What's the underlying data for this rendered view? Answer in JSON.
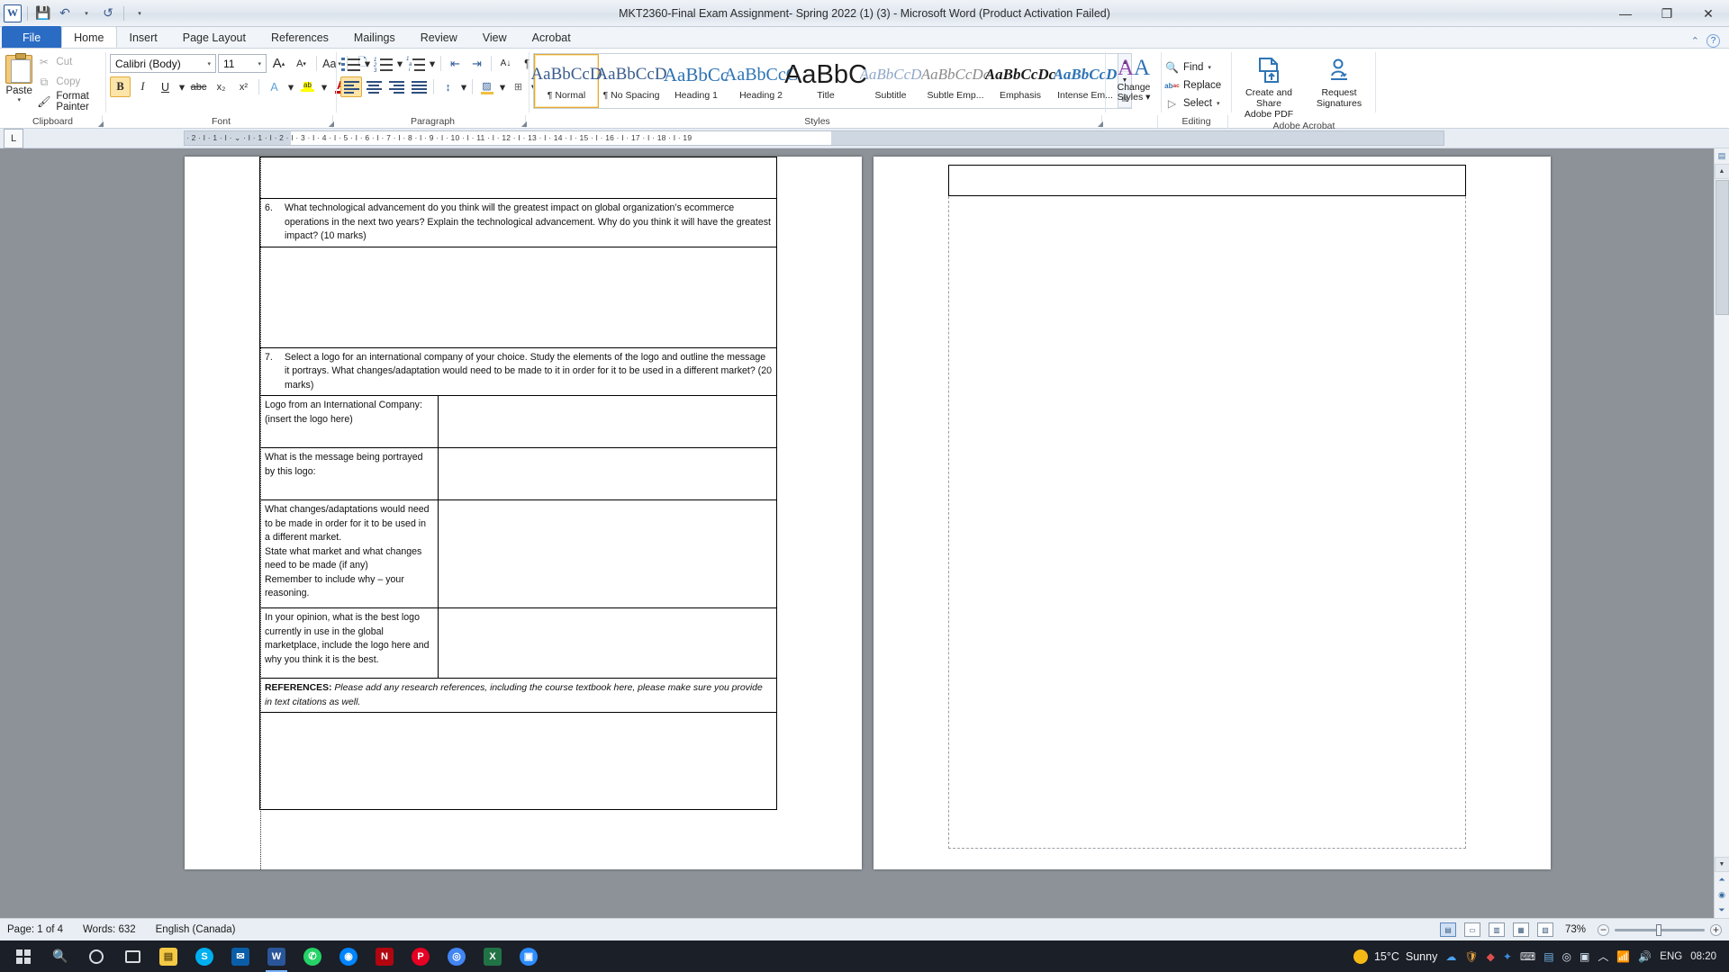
{
  "window": {
    "title": "MKT2360-Final Exam Assignment- Spring 2022 (1) (3)  -  Microsoft Word (Product Activation Failed)",
    "minimize": "—",
    "restore": "❐",
    "close": "✕"
  },
  "quick_access": {
    "logo": "W",
    "save": "💾",
    "undo": "↶",
    "undo_caret": "▾",
    "redo": "↺",
    "customize": "▾"
  },
  "ribbon_tabs": [
    {
      "label": "File",
      "id": "file"
    },
    {
      "label": "Home",
      "id": "home"
    },
    {
      "label": "Insert",
      "id": "insert"
    },
    {
      "label": "Page Layout",
      "id": "page-layout"
    },
    {
      "label": "References",
      "id": "references"
    },
    {
      "label": "Mailings",
      "id": "mailings"
    },
    {
      "label": "Review",
      "id": "review"
    },
    {
      "label": "View",
      "id": "view"
    },
    {
      "label": "Acrobat",
      "id": "acrobat"
    }
  ],
  "ribbon_right": {
    "minimize_ribbon": "⌃",
    "help": "?"
  },
  "groups": {
    "clipboard": {
      "label": "Clipboard",
      "paste": "Paste",
      "paste_caret": "▾",
      "cut": "Cut",
      "copy": "Copy",
      "format_painter": "Format Painter",
      "cut_icon": "✂",
      "copy_icon": "⧉",
      "painter_icon": "🖌"
    },
    "font": {
      "label": "Font",
      "font_name": "Calibri (Body)",
      "font_size": "11",
      "grow": "A",
      "shrink": "A",
      "change_case": "Aa",
      "clear_formatting": "A",
      "bold": "B",
      "italic": "I",
      "underline": "U",
      "strikethrough": "abc",
      "subscript": "x₂",
      "superscript": "x²",
      "text_effects": "A",
      "highlight": "ab",
      "font_color": "A"
    },
    "paragraph": {
      "label": "Paragraph",
      "bullets": "bullets-icon",
      "numbering": "numbering-icon",
      "multilevel": "multilevel-list-icon",
      "decrease_indent": "⇤",
      "increase_indent": "⇥",
      "sort": "A↓",
      "show_marks": "¶",
      "align_left": "align-left-icon",
      "align_center": "align-center-icon",
      "align_right": "align-right-icon",
      "justify": "justify-icon",
      "line_spacing": "↕",
      "shading": "shading-icon",
      "borders": "borders-icon"
    },
    "styles": {
      "label": "Styles",
      "items": [
        {
          "preview": "AaBbCcD",
          "name": "¶ Normal",
          "selected": true
        },
        {
          "preview": "AaBbCcD",
          "name": "¶ No Spacing",
          "selected": false
        },
        {
          "preview": "AaBbCc",
          "name": "Heading 1",
          "selected": false
        },
        {
          "preview": "AaBbCcC",
          "name": "Heading 2",
          "selected": false
        },
        {
          "preview": "AaBbC",
          "name": "Title",
          "selected": false
        },
        {
          "preview": "AaBbCcD",
          "name": "Subtitle",
          "selected": false
        },
        {
          "preview": "AaBbCcDc",
          "name": "Subtle Emp...",
          "selected": false
        },
        {
          "preview": "AaBbCcDc",
          "name": "Emphasis",
          "selected": false
        },
        {
          "preview": "AaBbCcD",
          "name": "Intense Em...",
          "selected": false
        }
      ],
      "scroll_up": "▲",
      "scroll_down": "▼",
      "more": "▤"
    },
    "change_styles": {
      "label": "Change\nStyles",
      "line1": "Change",
      "line2": "Styles ▾",
      "icon": "AA"
    },
    "editing": {
      "label": "Editing",
      "find": "Find",
      "find_caret": "▾",
      "replace": "Replace",
      "select": "Select",
      "select_caret": "▾",
      "find_icon": "🔍",
      "replace_icon": "ab",
      "select_icon": "▷"
    },
    "acrobat": {
      "label": "Adobe Acrobat",
      "create_share": "Create and Share\nAdobe PDF",
      "create_share_l1": "Create and Share",
      "create_share_l2": "Adobe PDF",
      "request_sig_l1": "Request",
      "request_sig_l2": "Signatures"
    }
  },
  "ruler": {
    "tab_selector": "L",
    "marks": "·  2  ·  I  ·  1  ·  I  ·  ⌄  ·  I  ·  1  ·  I  ·  2  ·  I  ·  3  ·  I  ·  4  ·  I  ·  5  ·  I  ·  6  ·  I  ·  7  ·  I  ·  8  ·  I  ·  9  ·  I  ·  10 ·  I  ·  11 ·  I  ·  12 ·  I  ·  13 ·  I  ·  14 ·  I  ·  15 ·  I  ·  16 ·  I  ·  17 ·  I  ·  18 ·  I  ·  19"
  },
  "document": {
    "rows": [
      {
        "type": "blank_full",
        "text": ""
      },
      {
        "type": "question",
        "number": "6.",
        "text": "What technological advancement do you think will the greatest impact on global organization’s ecommerce operations in the next two years?  Explain the technological advancement.  Why do you think it will have the greatest impact?  (10 marks)"
      },
      {
        "type": "answer_full",
        "text": ""
      },
      {
        "type": "question",
        "number": "7.",
        "text": "Select a logo for an international company of your choice. Study the elements of the logo and outline the message it portrays.  What changes/adaptation  would need to be made to it in order for it to be used in a different market?  (20 marks)"
      },
      {
        "type": "pair",
        "left": "Logo from an International Company:\n(insert the logo here)",
        "right": ""
      },
      {
        "type": "pair",
        "left": "What is the message being portrayed by this logo:",
        "right": ""
      },
      {
        "type": "pair",
        "left": "What changes/adaptations  would need to be made in order for it to be used in a different market.\nState what market and what changes need to be made (if any)\nRemember to include why – your reasoning.",
        "right": ""
      },
      {
        "type": "pair",
        "left": "In your opinion, what is the best logo currently in use in the global marketplace, include the logo here and why you think it is the best.",
        "right": ""
      },
      {
        "type": "references",
        "label": "REFERENCES:",
        "text": "Please add any research references,  including the course textbook here, please make sure you provide in text citations as well."
      },
      {
        "type": "answer_full",
        "text": ""
      }
    ]
  },
  "status_bar": {
    "page": "Page: 1 of 4",
    "words": "Words: 632",
    "language": "English (Canada)",
    "zoom": "73%",
    "zoom_out": "−",
    "zoom_in": "+",
    "views": [
      "print-layout",
      "full-screen-reading",
      "web-layout",
      "outline",
      "draft"
    ]
  },
  "taskbar": {
    "start": "start-button",
    "items": [
      {
        "name": "search-icon",
        "glyph": "🔍",
        "color": "#1b1f27"
      },
      {
        "name": "cortana-icon",
        "glyph": "◯",
        "color": "#1b1f27"
      },
      {
        "name": "task-view-icon",
        "glyph": "▢",
        "color": "#1b1f27"
      },
      {
        "name": "file-explorer-icon",
        "glyph": "📁",
        "color": "#f6c945"
      },
      {
        "name": "skype-icon",
        "glyph": "S",
        "color": "#00aff0"
      },
      {
        "name": "mail-icon",
        "glyph": "✉",
        "color": "#0a5ea8"
      },
      {
        "name": "word-icon",
        "glyph": "W",
        "color": "#2a5699",
        "active": true
      },
      {
        "name": "whatsapp-icon",
        "glyph": "✆",
        "color": "#25d366"
      },
      {
        "name": "messenger-icon",
        "glyph": "◉",
        "color": "#0084ff"
      },
      {
        "name": "netflix-icon",
        "glyph": "N",
        "color": "#e50914"
      },
      {
        "name": "pinterest-icon",
        "glyph": "P",
        "color": "#e60023"
      },
      {
        "name": "chrome-icon",
        "glyph": "◎",
        "color": "#4285f4"
      },
      {
        "name": "excel-icon",
        "glyph": "X",
        "color": "#217346"
      },
      {
        "name": "zoom-icon",
        "glyph": "▣",
        "color": "#2d8cff"
      }
    ],
    "tray": {
      "weather_temp": "15°C",
      "weather_desc": "Sunny",
      "icons": [
        "onedrive-icon",
        "shield-icon",
        "antivirus-icon",
        "bluetooth-icon",
        "keyboard-icon",
        "network-icon",
        "chrome-tray-icon",
        "app-tray-icon",
        "onedrive-tray-icon",
        "chevron-up-icon",
        "wifi-icon",
        "volume-icon"
      ],
      "language": "ENG",
      "time": "08:20"
    }
  }
}
